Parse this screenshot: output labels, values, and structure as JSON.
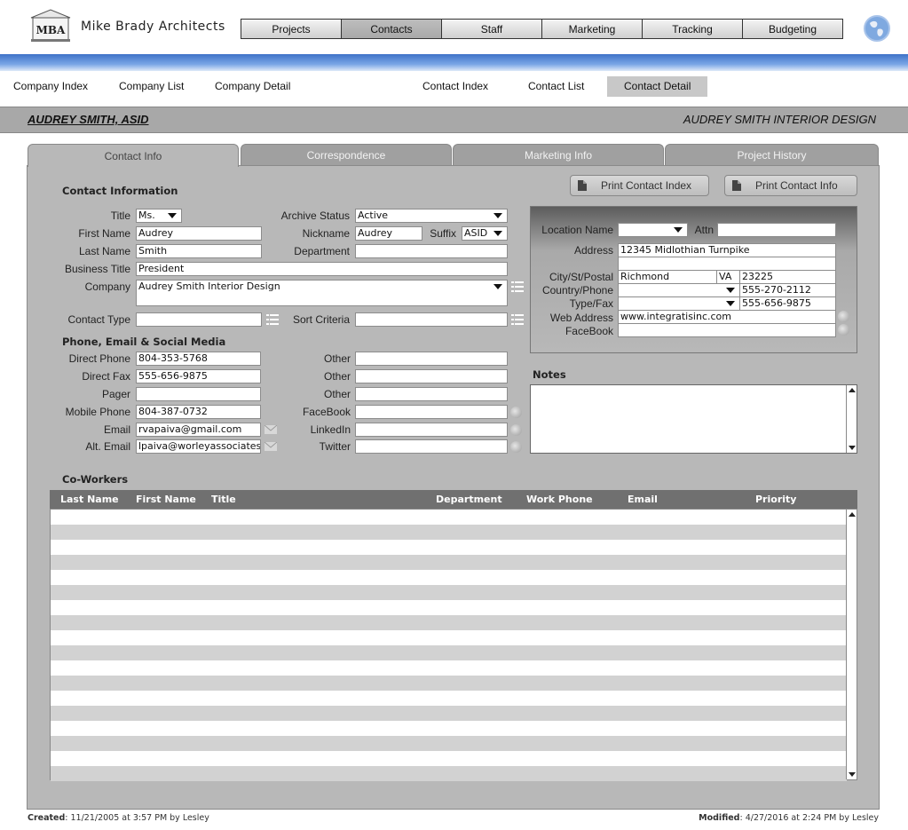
{
  "brand": {
    "logo_text": "MBA",
    "name": "Mike Brady Architects"
  },
  "main_nav": [
    "Projects",
    "Contacts",
    "Staff",
    "Marketing",
    "Tracking",
    "Budgeting"
  ],
  "main_nav_active": "Contacts",
  "sub_nav": {
    "company_index": "Company Index",
    "company_list": "Company List",
    "company_detail": "Company Detail",
    "contact_index": "Contact Index",
    "contact_list": "Contact List",
    "contact_detail": "Contact Detail"
  },
  "title": {
    "contact_name": "AUDREY SMITH, ASID",
    "company_name": "AUDREY SMITH INTERIOR DESIGN"
  },
  "tabs": [
    "Contact Info",
    "Correspondence",
    "Marketing Info",
    "Project History"
  ],
  "active_tab": "Contact Info",
  "buttons": {
    "print_index": "Print Contact Index",
    "print_info": "Print Contact Info"
  },
  "contact_info": {
    "heading": "Contact Information",
    "title_label": "Title",
    "title": "Ms.",
    "first_name_label": "First Name",
    "first_name": "Audrey",
    "last_name_label": "Last Name",
    "last_name": "Smith",
    "business_title_label": "Business Title",
    "business_title": "President",
    "company_label": "Company",
    "company": "Audrey Smith Interior Design",
    "contact_type_label": "Contact Type",
    "contact_type": "",
    "archive_status_label": "Archive Status",
    "archive_status": "Active",
    "nickname_label": "Nickname",
    "nickname": "Audrey",
    "suffix_label": "Suffix",
    "suffix": "ASID",
    "department_label": "Department",
    "department": "",
    "sort_criteria_label": "Sort Criteria",
    "sort_criteria": ""
  },
  "phone_email": {
    "heading": "Phone, Email & Social Media",
    "direct_phone_label": "Direct Phone",
    "direct_phone": "804-353-5768",
    "direct_fax_label": "Direct Fax",
    "direct_fax": "555-656-9875",
    "pager_label": "Pager",
    "pager": "",
    "mobile_phone_label": "Mobile Phone",
    "mobile_phone": "804-387-0732",
    "email_label": "Email",
    "email": "rvapaiva@gmail.com",
    "alt_email_label": "Alt. Email",
    "alt_email": "lpaiva@worleyassociates",
    "other_label": "Other",
    "other1": "",
    "other2": "",
    "other3": "",
    "facebook_label": "FaceBook",
    "facebook": "",
    "linkedin_label": "LinkedIn",
    "linkedin": "",
    "twitter_label": "Twitter",
    "twitter": ""
  },
  "location": {
    "location_name_label": "Location Name",
    "location_name": "",
    "attn_label": "Attn",
    "attn": "",
    "address_label": "Address",
    "address": "12345 Midlothian Turnpike",
    "address2": "",
    "city_label": "City/St/Postal",
    "city": "Richmond",
    "state": "VA",
    "postal": "23225",
    "country_label": "Country/Phone",
    "country": "",
    "phone": "555-270-2112",
    "type_label": "Type/Fax",
    "type": "",
    "fax": "555-656-9875",
    "web_label": "Web Address",
    "web": "www.integratisinc.com",
    "facebook_label": "FaceBook",
    "facebook": ""
  },
  "notes": {
    "heading": "Notes",
    "text": ""
  },
  "coworkers": {
    "heading": "Co-Workers",
    "columns": [
      "Last Name",
      "First Name",
      "Title",
      "Department",
      "Work Phone",
      "Email",
      "Priority"
    ],
    "rows": []
  },
  "footer": {
    "created_label": "Created",
    "created_value": ": 11/21/2005 at 3:57 PM by Lesley",
    "modified_label": "Modified",
    "modified_value": ": 4/27/2016 at 2:24 PM by Lesley"
  },
  "colors": {
    "accent_blue": "#3e72c8",
    "panel_gray": "#b8b8b8",
    "header_gray": "#707070"
  },
  "icons": [
    "mba-logo-icon",
    "globe-icon",
    "caret-down-icon",
    "list-icon",
    "mail-icon",
    "go-icon",
    "print-icon"
  ]
}
